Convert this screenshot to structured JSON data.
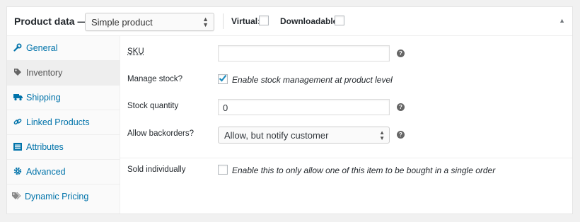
{
  "header": {
    "title": "Product data —",
    "product_type": "Simple product",
    "virtual_label": "Virtual:",
    "downloadable_label": "Downloadable:",
    "virtual_checked": false,
    "downloadable_checked": false,
    "toggle_icon": "caret-up-icon"
  },
  "tabs": [
    {
      "label": "General",
      "icon": "wrench-icon",
      "active": false
    },
    {
      "label": "Inventory",
      "icon": "tag-icon",
      "active": true
    },
    {
      "label": "Shipping",
      "icon": "truck-icon",
      "active": false
    },
    {
      "label": "Linked Products",
      "icon": "link-icon",
      "active": false
    },
    {
      "label": "Attributes",
      "icon": "list-icon",
      "active": false
    },
    {
      "label": "Advanced",
      "icon": "gear-icon",
      "active": false
    },
    {
      "label": "Dynamic Pricing",
      "icon": "tags-icon",
      "active": false
    }
  ],
  "fields": {
    "sku": {
      "label": "SKU",
      "value": ""
    },
    "manage_stock": {
      "label": "Manage stock?",
      "text": "Enable stock management at product level",
      "checked": true
    },
    "stock_quantity": {
      "label": "Stock quantity",
      "value": "0"
    },
    "backorders": {
      "label": "Allow backorders?",
      "value": "Allow, but notify customer"
    },
    "sold_individually": {
      "label": "Sold individually",
      "text": "Enable this to only allow one of this item to be bought in a single order",
      "checked": false
    }
  },
  "help_icon_text": "?",
  "colors": {
    "link": "#0073aa",
    "checkmark": "#1e8cbe",
    "active_tab_bg": "#eeeeee"
  }
}
